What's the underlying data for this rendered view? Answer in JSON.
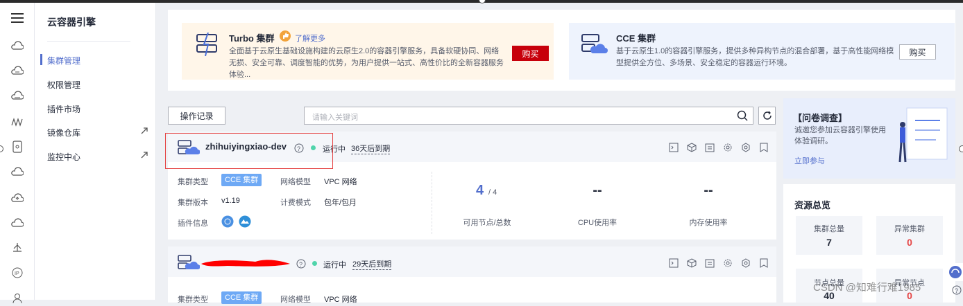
{
  "sidebar": {
    "title": "云容器引擎",
    "items": [
      {
        "label": "集群管理",
        "active": true
      },
      {
        "label": "权限管理"
      },
      {
        "label": "插件市场"
      },
      {
        "label": "镜像仓库",
        "external": true
      },
      {
        "label": "监控中心",
        "external": true
      }
    ]
  },
  "promos": {
    "turbo": {
      "title": "Turbo 集群",
      "learn_more": "了解更多",
      "description": "全面基于云原生基础设施构建的云原生2.0的容器引擎服务，具备软硬协同、网络无损、安全可靠、调度智能的优势，为用户提供一站式、高性价比的全新容器服务体验...",
      "buy": "购买"
    },
    "cce": {
      "title": "CCE 集群",
      "description": "基于云原生1.0的容器引擎服务，提供多种异构节点的混合部署，基于高性能网络模型提供全方位、多场景、安全稳定的容器运行环境。",
      "buy": "购买"
    }
  },
  "toolbar": {
    "ops_record": "操作记录",
    "search_placeholder": "请输入关键词"
  },
  "clusters": [
    {
      "name": "zhihuiyingxiao-dev",
      "status": "运行中",
      "expire": "36天后到期",
      "type_label": "集群类型",
      "type_value": "CCE 集群",
      "network_label": "网络模型",
      "network_value": "VPC 网络",
      "version_label": "集群版本",
      "version_value": "v1.19",
      "billing_label": "计费模式",
      "billing_value": "包年/包月",
      "plugin_label": "插件信息",
      "nodes_available": "4",
      "nodes_total": "/ 4",
      "nodes_label": "可用节点/总数",
      "cpu": "--",
      "cpu_label": "CPU使用率",
      "mem": "--",
      "mem_label": "内存使用率"
    },
    {
      "name": "",
      "status": "运行中",
      "expire": "29天后到期",
      "type_label": "集群类型",
      "type_value": "CCE 集群",
      "network_label": "网络模型",
      "network_value": "VPC 网络"
    }
  ],
  "survey": {
    "title": "【问卷调查】",
    "text": "诚邀您参加云容器引擎使用体验调研。",
    "link": "立即参与"
  },
  "resources": {
    "title": "资源总览",
    "cluster_total_label": "集群总量",
    "cluster_total": "7",
    "abnormal_cluster_label": "异常集群",
    "abnormal_cluster": "0",
    "node_total_label": "节点总量",
    "node_total": "40",
    "abnormal_node_label": "异常节点",
    "abnormal_node": "0"
  },
  "watermark": "CSDN @知难行难1985",
  "colors": {
    "accent": "#526ecc",
    "buy_red": "#c7000b",
    "running": "#50d4ab",
    "tag_blue": "#6ea9f5",
    "alert": "#e54545"
  }
}
